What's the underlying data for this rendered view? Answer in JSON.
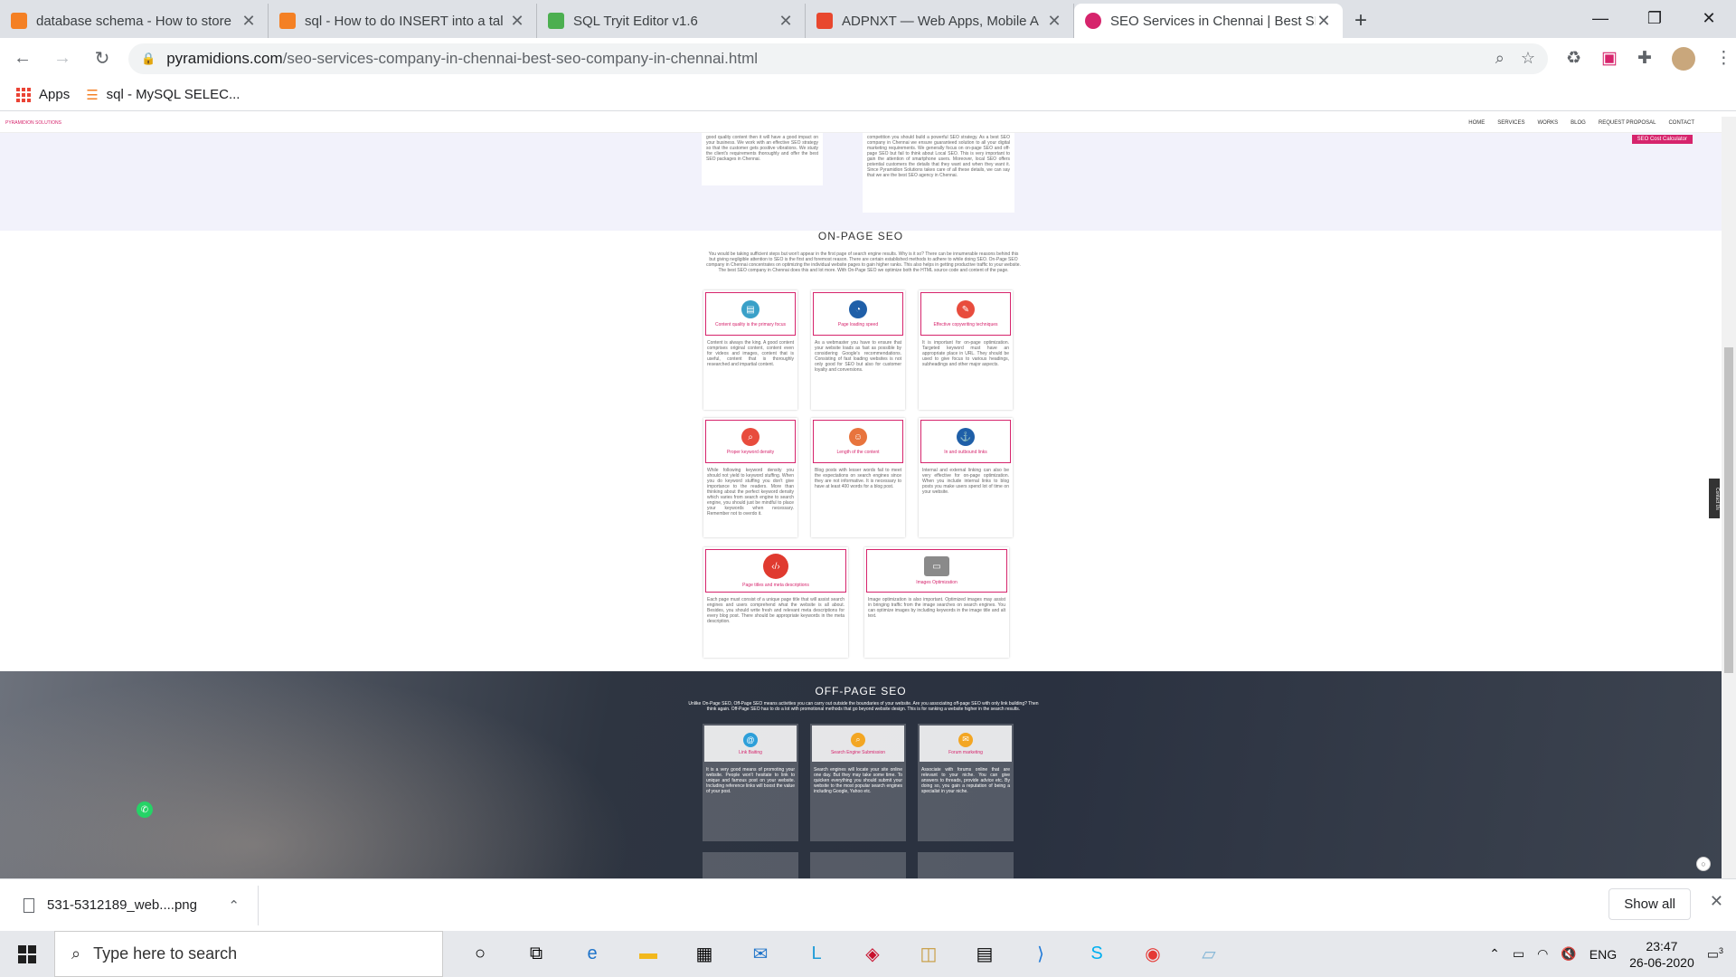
{
  "browser": {
    "tabs": [
      {
        "title": "database schema - How to store",
        "favicon_color": "#f48024"
      },
      {
        "title": "sql - How to do INSERT into a tal",
        "favicon_color": "#f48024"
      },
      {
        "title": "SQL Tryit Editor v1.6",
        "favicon_color": "#4caf50"
      },
      {
        "title": "ADPNXT — Web Apps, Mobile A",
        "favicon_color": "#e8472e"
      },
      {
        "title": "SEO Services in Chennai | Best SE",
        "favicon_color": "#d6246c"
      }
    ],
    "new_tab": "+",
    "url_domain": "pyramidions.com",
    "url_path": "/seo-services-company-in-chennai-best-seo-company-in-chennai.html",
    "bookmarks": [
      {
        "label": "Apps"
      },
      {
        "label": "sql - MySQL SELEC..."
      }
    ]
  },
  "site": {
    "logo": "PYRAMIDION SOLUTIONS",
    "nav": [
      "HOME",
      "SERVICES",
      "WORKS",
      "BLOG",
      "REQUEST PROPOSAL",
      "CONTACT"
    ],
    "cost_button": "SEO Cost Calculator",
    "top_card_left": "good quality content then it will have a good impact on your business. We work with an effective SEO strategy so that the customer gets positive vibrations. We study the client's requirements thoroughly and offer the best SEO packages in Chennai.",
    "top_card_right": "competition you should build a powerful SEO strategy. As a best SEO company in Chennai we ensure guaranteed solution to all your digital marketing requirements. We generally focus on on-page SEO and off-page SEO but fail to think about Local SEO. This is very important to gain the attention of smartphone users. Moreover, local SEO offers potential customers the details that they want and when they want it. Since Pyramidion Solutions takes care of all these details, we can say that we are the best SEO agency in Chennai.",
    "onpage_title": "ON-PAGE SEO",
    "onpage_intro": "You would be taking sufficient steps but won't appear in the first page of search engine results. Why is it so? There can be innumerable reasons behind this but giving negligible attention to SEO is the first and foremost reason. There are certain established methods to adhere to while doing SEO. On-Page SEO company in Chennai concentrates on optimizing the individual website pages to gain higher ranks. This also helps in getting productive traffic to your website. The best SEO company in Chennai does this and lot more. With On-Page SEO we optimize both the HTML source code and content of the page.",
    "onpage_cards": [
      {
        "label": "Content quality is the primary focus",
        "icon": "content-icon",
        "color": "#3aa0c8",
        "text": "Content is always the king. A good content comprises original content, content even for videos and images, content that is useful, content that is thoroughly researched and impartial content."
      },
      {
        "label": "Page loading speed",
        "icon": "speed-icon",
        "color": "#1f5fa8",
        "text": "As a webmaster you have to ensure that your website loads as fast as possible by considering Google's recommendations. Consisting of fast loading websites is not only good for SEO but also for customer loyalty and conversions."
      },
      {
        "label": "Effective copywriting techniques",
        "icon": "copywriting-icon",
        "color": "#e84c3d",
        "text": "It is important for on-page optimization. Targeted keyword must have an appropriate place in URL. They should be used to give focus to various headings, subheadings and other major aspects."
      },
      {
        "label": "Proper keyword density",
        "icon": "keyword-icon",
        "color": "#e84c3d",
        "text": "While following keyword density you should not yield to keyword stuffing. When you do keyword stuffing you don't give importance to the readers. More than thinking about the perfect keyword density which varies from search engine to search engine, you should just be mindful to place your keywords when necessary. Remember not to overdo it."
      },
      {
        "label": "Length of the content",
        "icon": "length-icon",
        "color": "#e8743d",
        "text": "Blog posts with lesser words fail to meet the expectations on search engines since they are not informative. It is necessary to have at least 400 words for a blog post."
      },
      {
        "label": "In and outbound links",
        "icon": "links-icon",
        "color": "#1f5fa8",
        "text": "Internal and external linking can also be very effective for on-page optimization. When you include internal links to blog posts you make users spend lot of time on your website."
      },
      {
        "label": "Page titles and meta descriptions",
        "icon": "code-icon",
        "color": "#e03a2f",
        "text": "Each page must consist of a unique page title that will assist search engines and users comprehend what the website is all about. Besides, you should write fresh and relevant meta descriptions for every blog post. There should be appropriate keywords in the meta description."
      },
      {
        "label": "Images Optimization",
        "icon": "image-icon",
        "color": "#8a8a8a",
        "text": "Image optimization is also important. Optimized images may assist in bringing traffic from the image searches on search engines. You can optimize images by including keywords in the image title and alt text."
      }
    ],
    "offpage_title": "OFF-PAGE SEO",
    "offpage_intro": "Unlike On-Page SEO, Off-Page SEO means activities you can carry out outside the boundaries of your website. Are you associating off-page SEO with only link building? Then think again. Off-Page SEO has to do a lot with promotional methods that go beyond website design. This is for ranking a website higher in the search results.",
    "offpage_cards": [
      {
        "label": "Link Baiting",
        "icon": "at-icon",
        "color": "#2d9fd9",
        "text": "It is a very good means of promoting your website. People won't hesitate to link to unique and famous post on your website. Including reference links will boost the value of your post."
      },
      {
        "label": "Search Engine Submission",
        "icon": "search-icon",
        "color": "#f3a623",
        "text": "Search engines will locate your site online one day. But they may take some time. To quicken everything you should submit your website to the most popular search engines including Google, Yahoo etc."
      },
      {
        "label": "Forum marketing",
        "icon": "forum-icon",
        "color": "#f3a623",
        "text": "Associate with forums online that are relevant to your niche. You can give answers to threads, provide advice etc. By doing so, you gain a reputation of being a specialist in your niche."
      }
    ],
    "contact_tab": "Contact Us"
  },
  "downloads": {
    "file": "531-5312189_web....png",
    "show_all": "Show all"
  },
  "taskbar": {
    "search_placeholder": "Type here to search",
    "lang": "ENG",
    "time": "23:47",
    "date": "26-06-2020",
    "notifications": "3"
  }
}
